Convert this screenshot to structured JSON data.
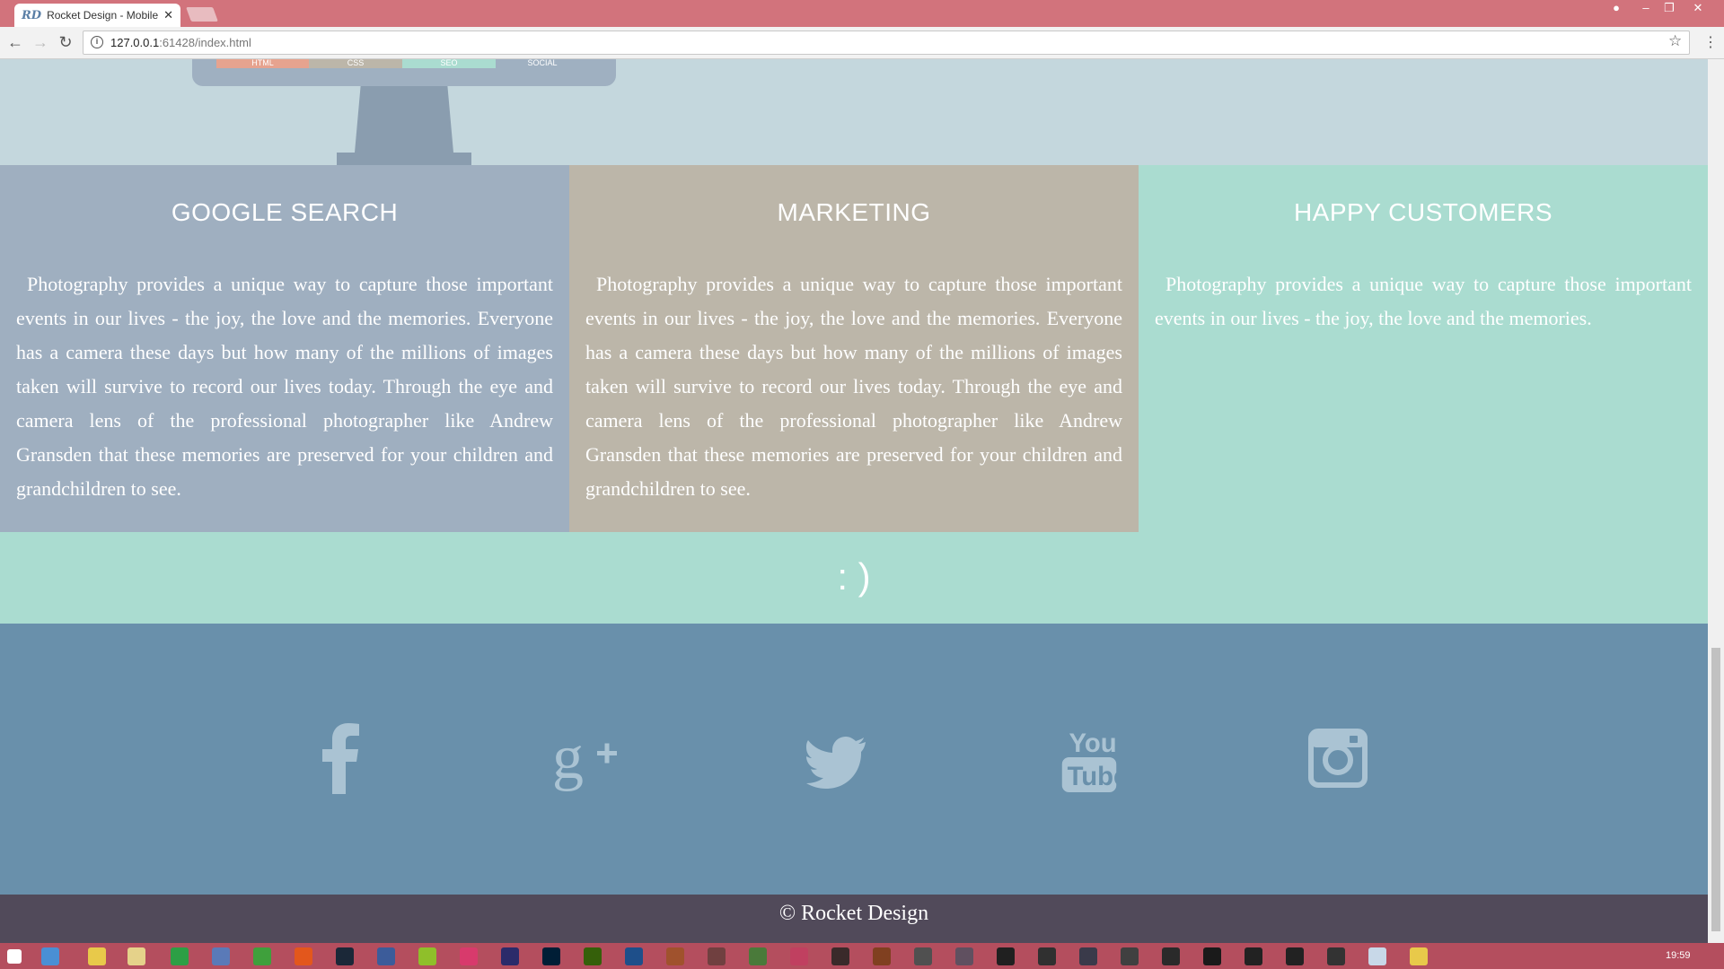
{
  "browser": {
    "tab_title": "Rocket Design - Mobile W",
    "favicon": "RD",
    "url_host": "127.0.0.1",
    "url_rest": ":61428/index.html"
  },
  "hero": {
    "bars": [
      "HTML",
      "CSS",
      "SEO",
      "SOCIAL"
    ]
  },
  "features": [
    {
      "title": "GOOGLE SEARCH",
      "text": "Photography provides a unique way to capture those important events in our lives - the joy, the love and the memories. Everyone has a camera these days but how many of the millions of images taken will survive to record our lives today. Through the eye and camera lens of the professional photographer like Andrew Gransden that these memories are preserved for your children and grandchildren to see.",
      "color": "#9fafc0"
    },
    {
      "title": "MARKETING",
      "text": "Photography provides a unique way to capture those important events in our lives - the joy, the love and the memories. Everyone has a camera these days but how many of the millions of images taken will survive to record our lives today. Through the eye and camera lens of the professional photographer like Andrew Gransden that these memories are preserved for your children and grandchildren to see.",
      "color": "#bcb6a9"
    },
    {
      "title": "HAPPY CUSTOMERS",
      "text": "Photography provides a unique way to capture those important events in our lives - the joy, the love and the memories.",
      "color": "#aadcd0"
    }
  ],
  "smile": ": )",
  "social": [
    "facebook-icon",
    "google-plus-icon",
    "twitter-icon",
    "youtube-icon",
    "instagram-icon"
  ],
  "footer": {
    "copyright": "© Rocket Design"
  },
  "taskbar": {
    "clock": "19:59"
  }
}
